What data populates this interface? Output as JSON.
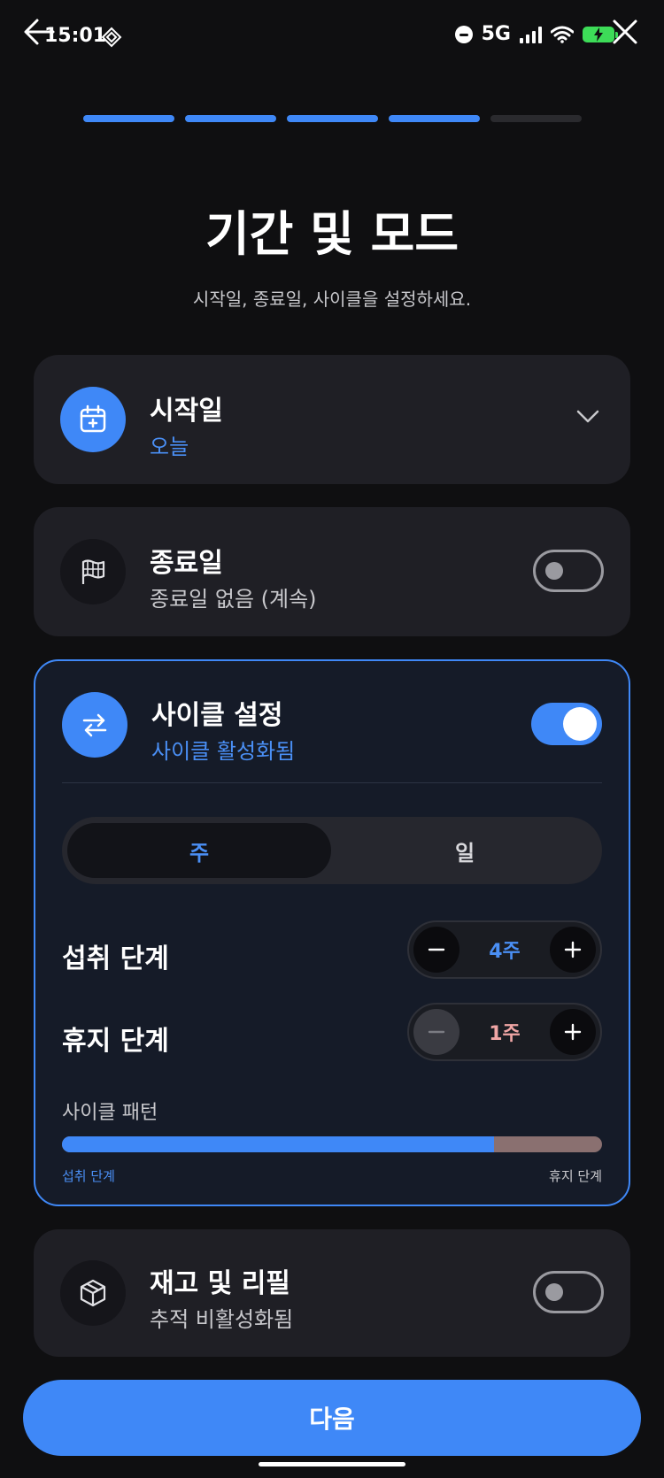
{
  "status": {
    "time": "15:01",
    "network": "5G",
    "battery_color": "#3ddc58"
  },
  "nav": {
    "steps_total": 5,
    "steps_done": 4,
    "back_icon": "arrow-left-icon",
    "close_icon": "close-icon"
  },
  "header": {
    "title": "기간 및 모드",
    "subtitle": "시작일, 종료일, 사이클을 설정하세요."
  },
  "start_date": {
    "title": "시작일",
    "value": "오늘",
    "icon": "calendar-icon"
  },
  "end_date": {
    "title": "종료일",
    "value": "종료일 없음 (계속)",
    "icon": "flag-icon",
    "enabled": false
  },
  "cycle": {
    "title": "사이클 설정",
    "status": "사이클 활성화됨",
    "enabled": true,
    "unit_options": [
      "주",
      "일"
    ],
    "selected_unit": "주",
    "intake": {
      "label": "섭취 단계",
      "value": "4주",
      "value_color": "#4a8ff5"
    },
    "rest": {
      "label": "휴지 단계",
      "value": "1주",
      "value_color": "#f0a5a5"
    },
    "pattern_label": "사이클 패턴",
    "pattern_intake_fraction": 0.8,
    "legend_intake": "섭취 단계",
    "legend_rest": "휴지 단계"
  },
  "inventory": {
    "title": "재고 및 리필",
    "status": "추적 비활성화됨",
    "icon": "box-icon",
    "enabled": false
  },
  "footer": {
    "next_label": "다음"
  },
  "colors": {
    "accent": "#3f88f7",
    "background": "#0f0f11",
    "card": "#1f1f25",
    "rest": "#8a7070"
  }
}
